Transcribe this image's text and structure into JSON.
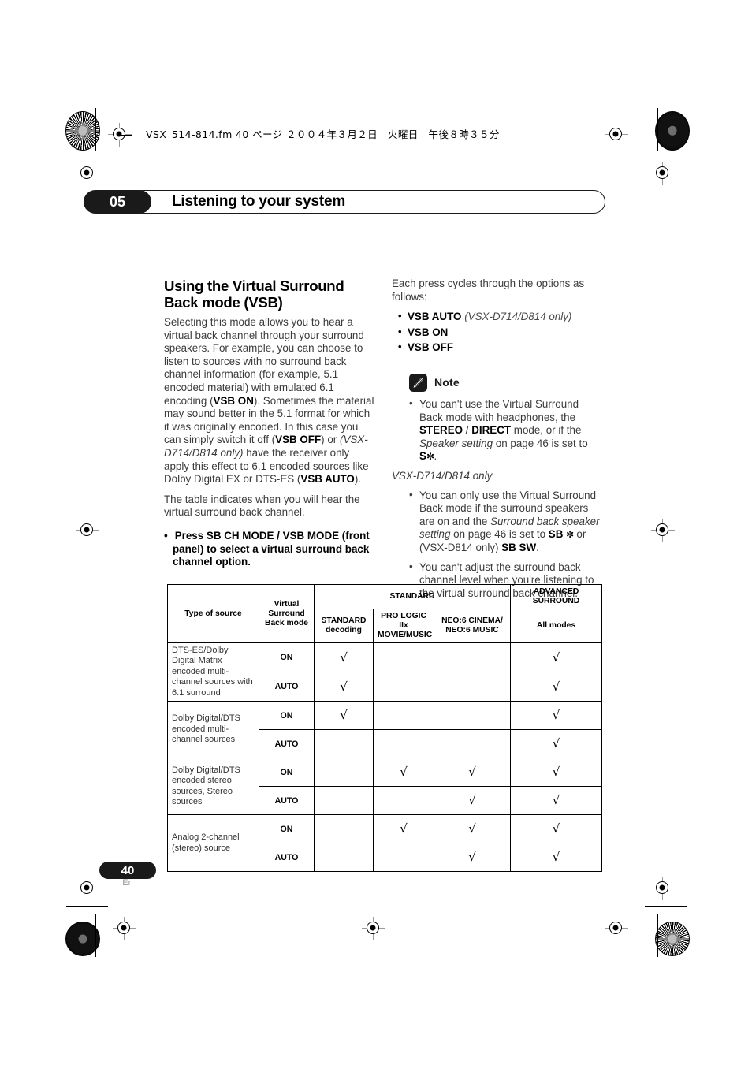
{
  "print_header": {
    "text": "VSX_514-814.fm  40 ページ  ２００４年３月２日　火曜日　午後８時３５分"
  },
  "chapter": {
    "number": "05",
    "title": "Listening to your system"
  },
  "left_column": {
    "section_title": "Using the Virtual Surround Back mode (VSB)",
    "para1_a": "Selecting this mode allows you to hear a virtual back channel through your surround speakers. For example, you can choose to listen to sources with no surround back channel information (for example, 5.1 encoded material) with emulated 6.1 encoding (",
    "para1_b": "VSB ON",
    "para1_c": "). Sometimes the material may sound better in the 5.1 format for which it was originally encoded. In this case you can simply switch it off (",
    "para1_d": "VSB OFF",
    "para1_e": ") or ",
    "para1_f": "(VSX-D714/D814 only)",
    "para1_g": " have the receiver only apply this effect to 6.1 encoded sources like Dolby Digital EX or DTS-ES (",
    "para1_h": "VSB AUTO",
    "para1_i": ").",
    "para2": "The table indicates when you will hear the virtual surround back channel.",
    "command_bullet": "•",
    "command": "Press SB CH MODE / VSB MODE (front panel) to select a virtual surround back channel option."
  },
  "right_column": {
    "intro": "Each press cycles through the options as follows:",
    "options": [
      {
        "label": "VSB AUTO",
        "qualifier": "(VSX-D714/D814 only)"
      },
      {
        "label": "VSB ON",
        "qualifier": ""
      },
      {
        "label": "VSB OFF",
        "qualifier": ""
      }
    ],
    "note_label": "Note",
    "note_icon": "pencil-icon",
    "notes": [
      {
        "a": "You can't use the Virtual Surround Back mode with headphones, the ",
        "b": "STEREO",
        "c": " / ",
        "d": "DIRECT",
        "e": " mode, or if the ",
        "f": "Speaker setting",
        "g": " on page 46 is set to ",
        "h": "S",
        "i": "✻",
        "j": "."
      }
    ],
    "model_note": "VSX-D714/D814 only",
    "notes2": [
      {
        "a": "You can only use the Virtual Surround Back mode if the surround speakers are on and the ",
        "b": "Surround back speaker setting",
        "c": " on page 46 is set to ",
        "d": "SB",
        "e": "✻",
        "f": " or (VSX-D814 only) ",
        "g": "SB SW",
        "h": "."
      },
      {
        "a": "You can't adjust the surround back channel level when you're listening to the virtual surround back channel.",
        "b": "",
        "c": "",
        "d": "",
        "e": "",
        "f": "",
        "g": "",
        "h": ""
      }
    ]
  },
  "table": {
    "headers": {
      "type_of_source": "Type of source",
      "vsb_mode": "Virtual Surround Back mode",
      "standard_group": "STANDARD",
      "advanced_group": "ADVANCED SURROUND",
      "standard_decoding": "STANDARD decoding",
      "pro_logic": "PRO LOGIC IIx MOVIE/MUSIC",
      "neo6": "NEO:6 CINEMA/ NEO:6 MUSIC",
      "all_modes": "All modes"
    },
    "check_mark": "√",
    "rows": [
      {
        "source": "DTS-ES/Dolby Digital Matrix encoded multi-channel sources with 6.1 surround",
        "modes": [
          {
            "mode": "ON",
            "standard": true,
            "prologic": false,
            "neo6": false,
            "advanced": true
          },
          {
            "mode": "AUTO",
            "standard": true,
            "prologic": false,
            "neo6": false,
            "advanced": true
          }
        ]
      },
      {
        "source": "Dolby Digital/DTS encoded multi-channel sources",
        "modes": [
          {
            "mode": "ON",
            "standard": true,
            "prologic": false,
            "neo6": false,
            "advanced": true
          },
          {
            "mode": "AUTO",
            "standard": false,
            "prologic": false,
            "neo6": false,
            "advanced": true
          }
        ]
      },
      {
        "source": "Dolby Digital/DTS encoded stereo sources, Stereo sources",
        "modes": [
          {
            "mode": "ON",
            "standard": false,
            "prologic": true,
            "neo6": true,
            "advanced": true
          },
          {
            "mode": "AUTO",
            "standard": false,
            "prologic": false,
            "neo6": true,
            "advanced": true
          }
        ]
      },
      {
        "source": "Analog 2-channel (stereo) source",
        "modes": [
          {
            "mode": "ON",
            "standard": false,
            "prologic": true,
            "neo6": true,
            "advanced": true
          },
          {
            "mode": "AUTO",
            "standard": false,
            "prologic": false,
            "neo6": true,
            "advanced": true
          }
        ]
      }
    ]
  },
  "footer": {
    "page_number": "40",
    "language": "En"
  }
}
